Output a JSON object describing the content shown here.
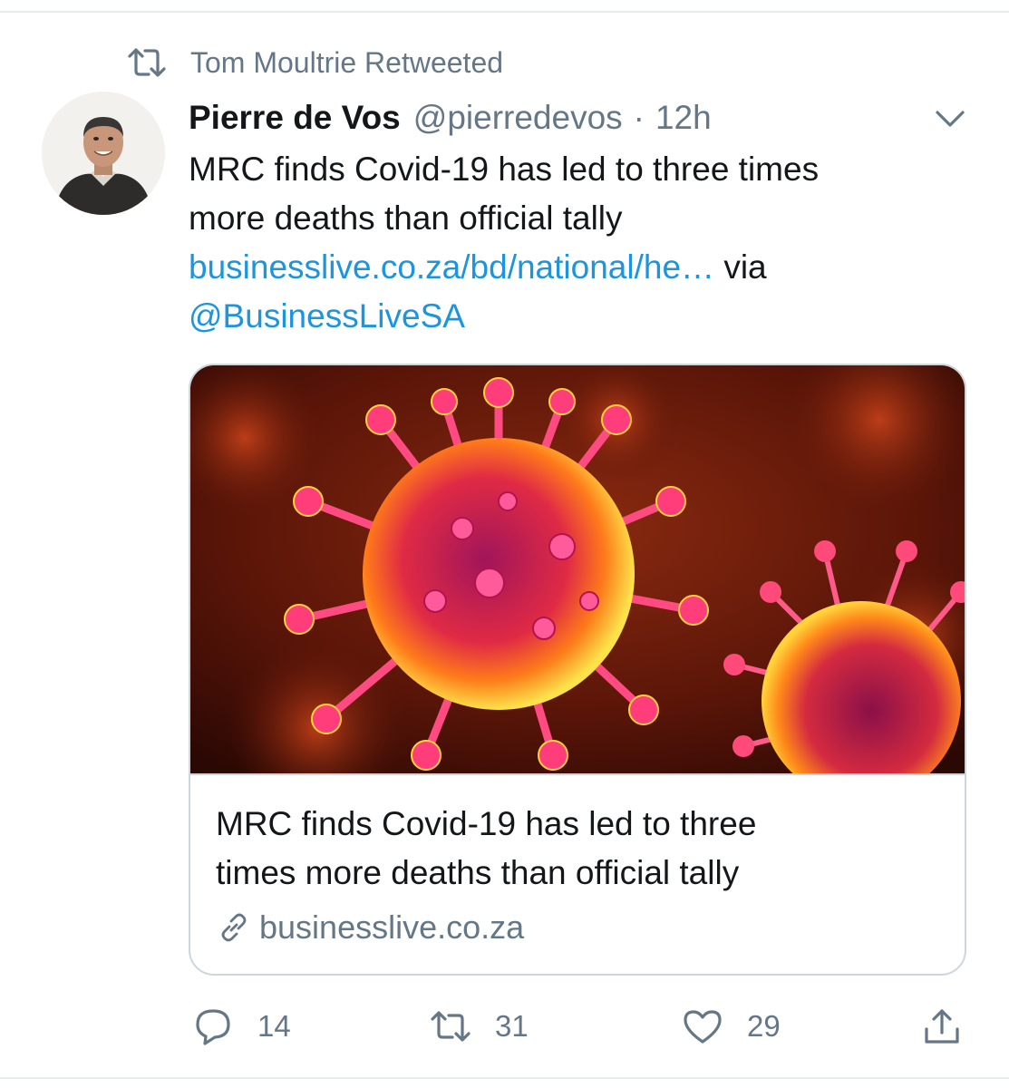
{
  "retweet": {
    "icon": "retweet-icon",
    "text": "Tom Moultrie Retweeted"
  },
  "tweet": {
    "author": {
      "display_name": "Pierre de Vos",
      "handle": "@pierredevos",
      "separator": "·",
      "time": "12h",
      "avatar_icon": "avatar"
    },
    "text_line1": "MRC finds Covid-19 has led to three times",
    "text_line2": "more deaths than official tally",
    "link_url": "businesslive.co.za/bd/national/he…",
    "via": "via",
    "mention": "@BusinessLiveSA",
    "menu_icon": "chevron-down-icon"
  },
  "card": {
    "title_line1": "MRC finds Covid-19 has led to three",
    "title_line2": "times more deaths than official tally",
    "domain": "businesslive.co.za",
    "domain_icon": "link-icon",
    "image_icon": "coronavirus-image"
  },
  "actions": {
    "reply": {
      "icon": "reply-icon",
      "count": "14"
    },
    "retweet": {
      "icon": "retweet-icon",
      "count": "31"
    },
    "like": {
      "icon": "heart-icon",
      "count": "29"
    },
    "share": {
      "icon": "share-icon"
    }
  },
  "colors": {
    "link": "#1b95e0",
    "muted": "#657786",
    "text": "#14171a",
    "border": "#ccd6dd"
  }
}
